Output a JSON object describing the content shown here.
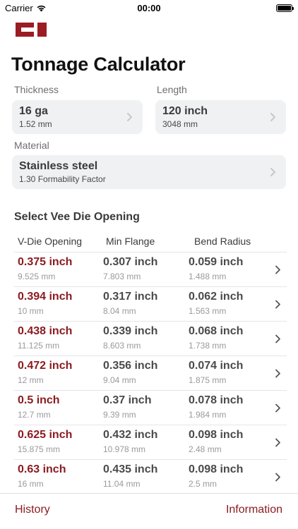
{
  "status": {
    "carrier": "Carrier",
    "time": "00:00"
  },
  "app": {
    "logo": "CI",
    "title": "Tonnage Calculator"
  },
  "inputs": {
    "thickness": {
      "label": "Thickness",
      "value": "16 ga",
      "sub": "1.52 mm"
    },
    "length": {
      "label": "Length",
      "value": "120 inch",
      "sub": "3048 mm"
    },
    "material": {
      "label": "Material",
      "value": "Stainless steel",
      "sub": "1.30 Formability Factor"
    }
  },
  "table": {
    "title": "Select Vee Die Opening",
    "headers": [
      "V-Die Opening",
      "Min Flange",
      "Bend Radius"
    ],
    "rows": [
      {
        "vdie": "0.375 inch",
        "vdie_mm": "9.525 mm",
        "flange": "0.307 inch",
        "flange_mm": "7.803 mm",
        "radius": "0.059 inch",
        "radius_mm": "1.488 mm"
      },
      {
        "vdie": "0.394 inch",
        "vdie_mm": "10 mm",
        "flange": "0.317 inch",
        "flange_mm": "8.04 mm",
        "radius": "0.062 inch",
        "radius_mm": "1.563 mm"
      },
      {
        "vdie": "0.438 inch",
        "vdie_mm": "11.125 mm",
        "flange": "0.339 inch",
        "flange_mm": "8.603 mm",
        "radius": "0.068 inch",
        "radius_mm": "1.738 mm"
      },
      {
        "vdie": "0.472 inch",
        "vdie_mm": "12 mm",
        "flange": "0.356 inch",
        "flange_mm": "9.04 mm",
        "radius": "0.074 inch",
        "radius_mm": "1.875 mm"
      },
      {
        "vdie": "0.5 inch",
        "vdie_mm": "12.7 mm",
        "flange": "0.37 inch",
        "flange_mm": "9.39 mm",
        "radius": "0.078 inch",
        "radius_mm": "1.984 mm"
      },
      {
        "vdie": "0.625 inch",
        "vdie_mm": "15.875 mm",
        "flange": "0.432 inch",
        "flange_mm": "10.978 mm",
        "radius": "0.098 inch",
        "radius_mm": "2.48 mm"
      },
      {
        "vdie": "0.63 inch",
        "vdie_mm": "16 mm",
        "flange": "0.435 inch",
        "flange_mm": "11.04 mm",
        "radius": "0.098 inch",
        "radius_mm": "2.5 mm"
      }
    ]
  },
  "bottom": {
    "history": "History",
    "information": "Information"
  },
  "colors": {
    "accent": "#8b1a1f",
    "card_bg": "#f0f1f3"
  },
  "icons": {
    "wifi": "wifi-icon",
    "battery": "battery-icon",
    "chevron": "chevron-right-icon"
  }
}
